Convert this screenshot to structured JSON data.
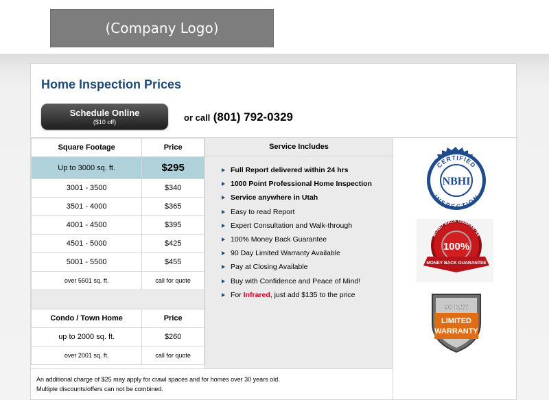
{
  "logo": {
    "text": "(Company Logo)"
  },
  "header": {
    "title": "Home Inspection Prices",
    "schedule_label": "Schedule Online",
    "schedule_sub": "($10 off)",
    "call_prefix": "or call",
    "phone": "(801) 792-0329"
  },
  "sqft_table": {
    "headers": [
      "Square Footage",
      "Price"
    ],
    "rows": [
      {
        "size": "Up to 3000 sq. ft.",
        "price": "$295"
      },
      {
        "size": "3001 - 3500",
        "price": "$340"
      },
      {
        "size": "3501 - 4000",
        "price": "$365"
      },
      {
        "size": "4001 - 4500",
        "price": "$395"
      },
      {
        "size": "4501 - 5000",
        "price": "$425"
      },
      {
        "size": "5001 - 5500",
        "price": "$455"
      },
      {
        "size": "over 5501 sq. ft.",
        "price": "call for quote"
      }
    ]
  },
  "condo_table": {
    "headers": [
      "Condo / Town Home",
      "Price"
    ],
    "rows": [
      {
        "size": "up to 2000 sq. ft.",
        "price": "$260"
      },
      {
        "size": "over 2001 sq. ft.",
        "price": "call for quote"
      }
    ]
  },
  "services": {
    "header": "Service Includes",
    "items": [
      "Full Report delivered within 24 hrs",
      "1000 Point Professional Home Inspection",
      "Service anywhere in Utah",
      "Easy to read Report",
      "Expert Consultation and Walk-through",
      "100% Money Back Guarantee",
      "90 Day Limited Warranty Available",
      "Pay at Closing Available",
      "Buy with Confidence and Peace of Mind!"
    ],
    "infrared_pre": "For",
    "infrared_word": "Infrared",
    "infrared_post": ", just add $135 to the price"
  },
  "badges": {
    "certified_top": "CERTIFIED",
    "certified_center": "NBHI",
    "certified_bottom": "INSPECTION",
    "money_arc_top": "MONEY BACK GUARANTEE",
    "money_center": "100%",
    "money_ribbon": "MONEY BACK GUARANTEE",
    "warranty_line1": "90 DAY",
    "warranty_line2": "LIMITED",
    "warranty_line3": "WARRANTY"
  },
  "notes": {
    "line1": "An additional charge of $25 may apply for crawl spaces and for homes over 30 years old.",
    "line2": "Multiple discounts/offers can not be combined."
  },
  "colors": {
    "title": "#1d4a75",
    "highlight_row": "#afd1d9",
    "service_bg": "#ebebeb",
    "infrared": "#c8001e"
  }
}
